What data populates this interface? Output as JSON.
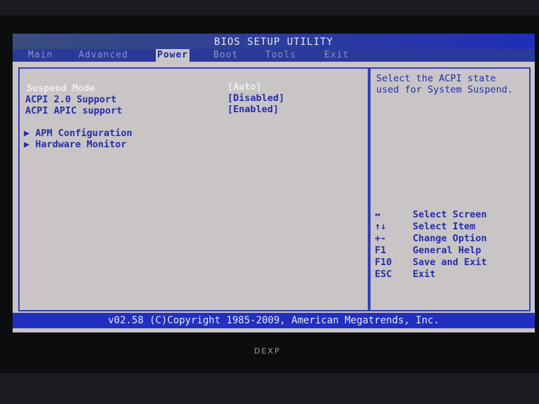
{
  "title": "BIOS SETUP UTILITY",
  "tabs": [
    "Main",
    "Advanced",
    "Power",
    "Boot",
    "Tools",
    "Exit"
  ],
  "active_tab": "Power",
  "settings": [
    {
      "label": "Suspend Mode",
      "value": "[Auto]"
    },
    {
      "label": "ACPI 2.0 Support",
      "value": "[Disabled]"
    },
    {
      "label": "ACPI APIC support",
      "value": "[Enabled]"
    }
  ],
  "submenus": [
    "APM Configuration",
    "Hardware Monitor"
  ],
  "submenu_icon": "triangle-right",
  "help_text": "Select the ACPI state used for System Suspend.",
  "keys": [
    {
      "key": "↔",
      "action": "Select Screen"
    },
    {
      "key": "↑↓",
      "action": "Select Item"
    },
    {
      "key": "+-",
      "action": "Change Option"
    },
    {
      "key": "F1",
      "action": "General Help"
    },
    {
      "key": "F10",
      "action": "Save and Exit"
    },
    {
      "key": "ESC",
      "action": "Exit"
    }
  ],
  "footer": "v02.58 (C)Copyright 1985-2009, American Megatrends, Inc.",
  "monitor_brand": "DEXP",
  "colors": {
    "title_bar": "#1f2fb8",
    "text": "#2530a8",
    "background": "#c9c4c6"
  }
}
